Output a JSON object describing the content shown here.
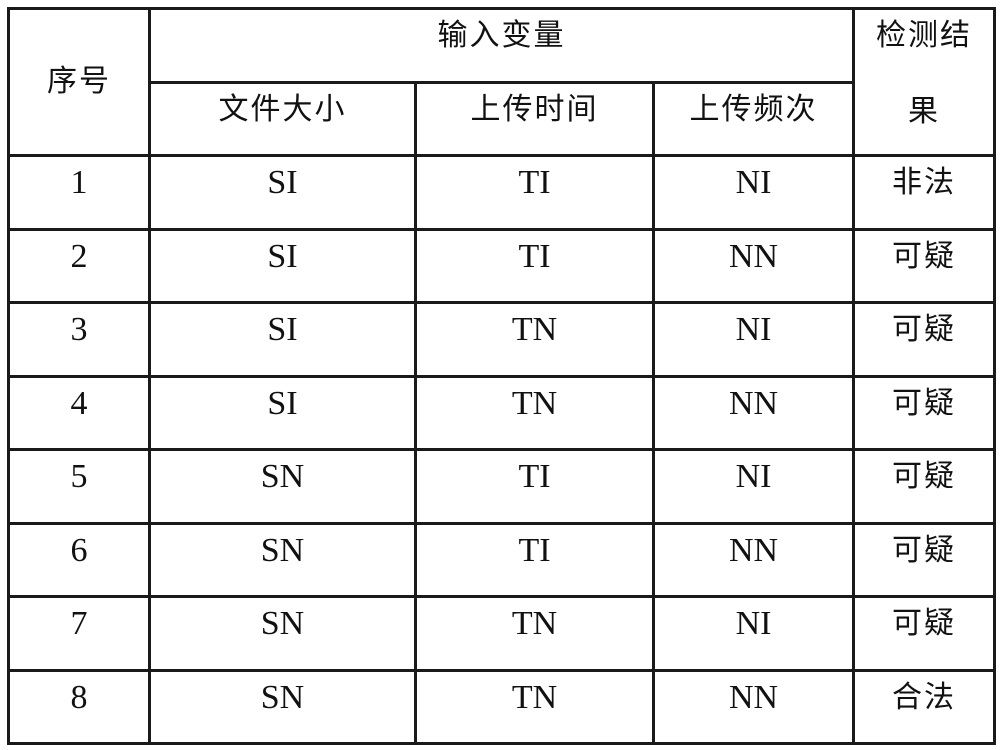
{
  "table": {
    "headers": {
      "index": "序号",
      "input_variables": "输入变量",
      "result": "检测结果",
      "result_line1": "检测结",
      "result_line2": "果",
      "file_size": "文件大小",
      "upload_time": "上传时间",
      "upload_frequency": "上传频次"
    },
    "rows": [
      {
        "index": "1",
        "file_size": "SI",
        "upload_time": "TI",
        "upload_frequency": "NI",
        "result": "非法"
      },
      {
        "index": "2",
        "file_size": "SI",
        "upload_time": "TI",
        "upload_frequency": "NN",
        "result": "可疑"
      },
      {
        "index": "3",
        "file_size": "SI",
        "upload_time": "TN",
        "upload_frequency": "NI",
        "result": "可疑"
      },
      {
        "index": "4",
        "file_size": "SI",
        "upload_time": "TN",
        "upload_frequency": "NN",
        "result": "可疑"
      },
      {
        "index": "5",
        "file_size": "SN",
        "upload_time": "TI",
        "upload_frequency": "NI",
        "result": "可疑"
      },
      {
        "index": "6",
        "file_size": "SN",
        "upload_time": "TI",
        "upload_frequency": "NN",
        "result": "可疑"
      },
      {
        "index": "7",
        "file_size": "SN",
        "upload_time": "TN",
        "upload_frequency": "NI",
        "result": "可疑"
      },
      {
        "index": "8",
        "file_size": "SN",
        "upload_time": "TN",
        "upload_frequency": "NN",
        "result": "合法"
      }
    ]
  }
}
